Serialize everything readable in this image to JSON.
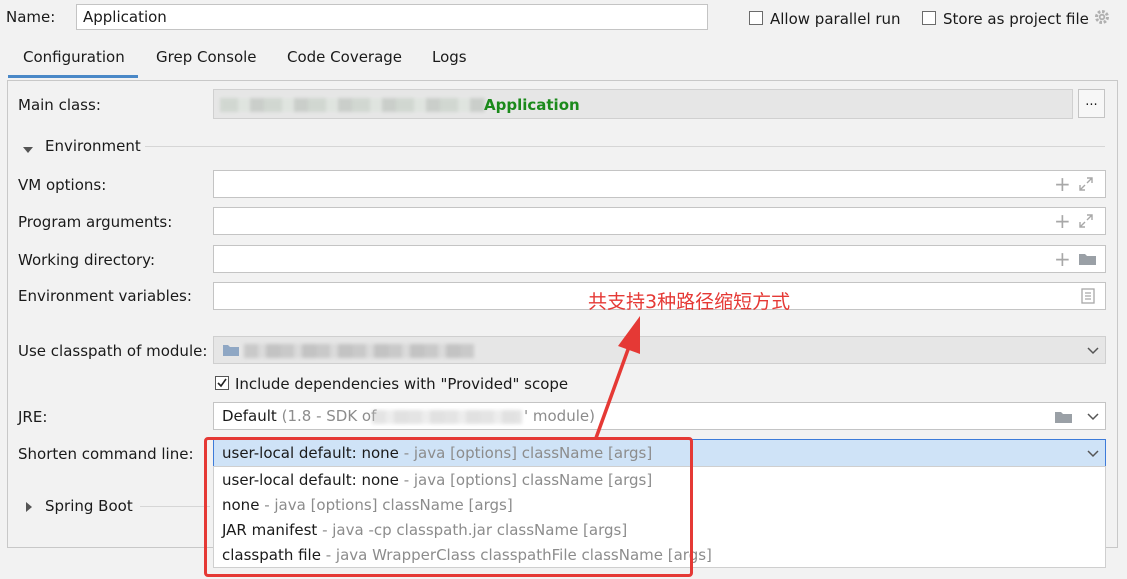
{
  "header": {
    "name_label": "Name:",
    "name_value": "Application",
    "allow_parallel_label": "Allow parallel run",
    "store_project_label": "Store as project file"
  },
  "tabs": [
    {
      "label": "Configuration"
    },
    {
      "label": "Grep Console"
    },
    {
      "label": "Code Coverage"
    },
    {
      "label": "Logs"
    }
  ],
  "form": {
    "main_class_label": "Main class:",
    "main_class_value": "Application",
    "browse_label": "...",
    "environment_label": "Environment",
    "vm_options_label": "VM options:",
    "program_args_label": "Program arguments:",
    "working_dir_label": "Working directory:",
    "env_vars_label": "Environment variables:",
    "classpath_label": "Use classpath of module:",
    "include_deps_label": "Include dependencies with \"Provided\" scope",
    "jre_label": "JRE:",
    "jre_value_main": "Default",
    "jre_value_hint_a": "(1.8 - SDK of",
    "jre_value_hint_b": "' module)",
    "shorten_label": "Shorten command line:",
    "shorten_value_main": "user-local default: none",
    "shorten_value_hint": "- java [options] className [args]",
    "spring_boot_label": "Spring Boot"
  },
  "dropdown": {
    "options": [
      {
        "main": "user-local default: none",
        "hint": "- java [options] className [args]"
      },
      {
        "main": "none",
        "hint": "- java [options] className [args]"
      },
      {
        "main": "JAR manifest",
        "hint": "- java -cp classpath.jar className [args]"
      },
      {
        "main": "classpath file",
        "hint": "- java WrapperClass classpathFile className [args]"
      }
    ]
  },
  "annotation": {
    "text": "共支持3种路径缩短方式",
    "color": "#e53935"
  },
  "colors": {
    "main_class_green": "#1b8a1b",
    "selected_bg": "#cfe3f7",
    "focus_border": "#3d7bd9"
  }
}
